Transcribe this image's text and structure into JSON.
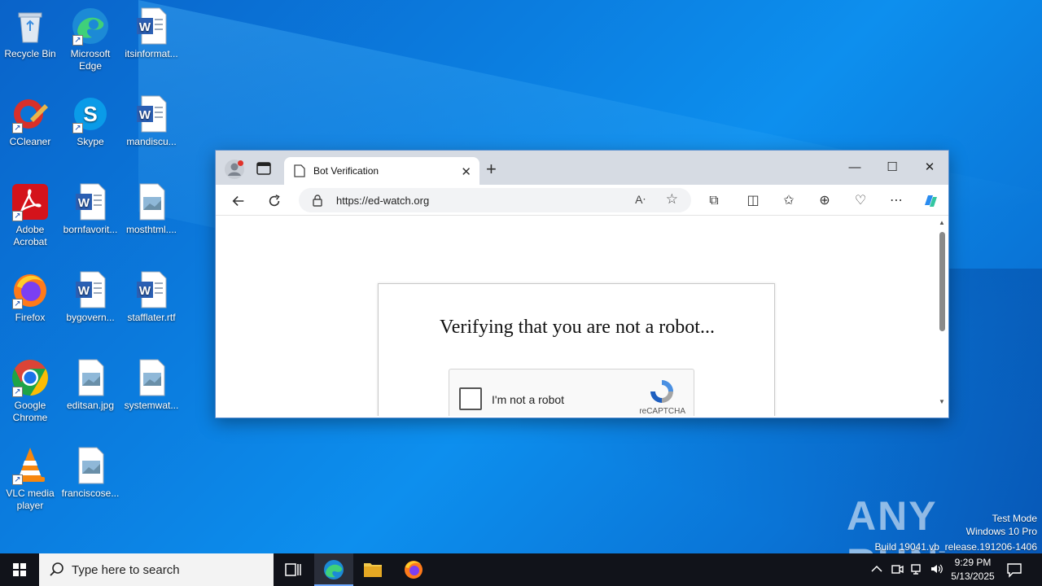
{
  "desktop": {
    "icons": [
      {
        "label": "Recycle Bin"
      },
      {
        "label": "Microsoft Edge"
      },
      {
        "label": "itsinformat..."
      },
      {
        "label": "CCleaner"
      },
      {
        "label": "Skype"
      },
      {
        "label": "mandiscu..."
      },
      {
        "label": "Adobe Acrobat"
      },
      {
        "label": "bornfavorit..."
      },
      {
        "label": "mosthtml...."
      },
      {
        "label": "Firefox"
      },
      {
        "label": "bygovern..."
      },
      {
        "label": "stafflater.rtf"
      },
      {
        "label": "Google Chrome"
      },
      {
        "label": "editsan.jpg"
      },
      {
        "label": "systemwat..."
      },
      {
        "label": "VLC media player"
      },
      {
        "label": "franciscose..."
      }
    ]
  },
  "browser": {
    "tab_title": "Bot Verification",
    "new_tab": "+",
    "tab_close": "✕",
    "url": "https://ed-watch.org",
    "window_controls": {
      "minimize": "—",
      "maximize": "☐",
      "close": "✕"
    }
  },
  "page": {
    "heading": "Verifying that you are not a robot...",
    "captcha_label": "I'm not a robot",
    "captcha_brand": "reCAPTCHA"
  },
  "watermark": {
    "logo": "ANY RUN",
    "line1": "Test Mode",
    "line2": "Windows 10 Pro",
    "line3": "Build 19041.vb_release.191206-1406"
  },
  "taskbar": {
    "search_placeholder": "Type here to search",
    "time": "9:29 PM",
    "date": "5/13/2025"
  },
  "colors": {
    "accent": "#0b7ee0",
    "taskbar": "#11131a"
  }
}
